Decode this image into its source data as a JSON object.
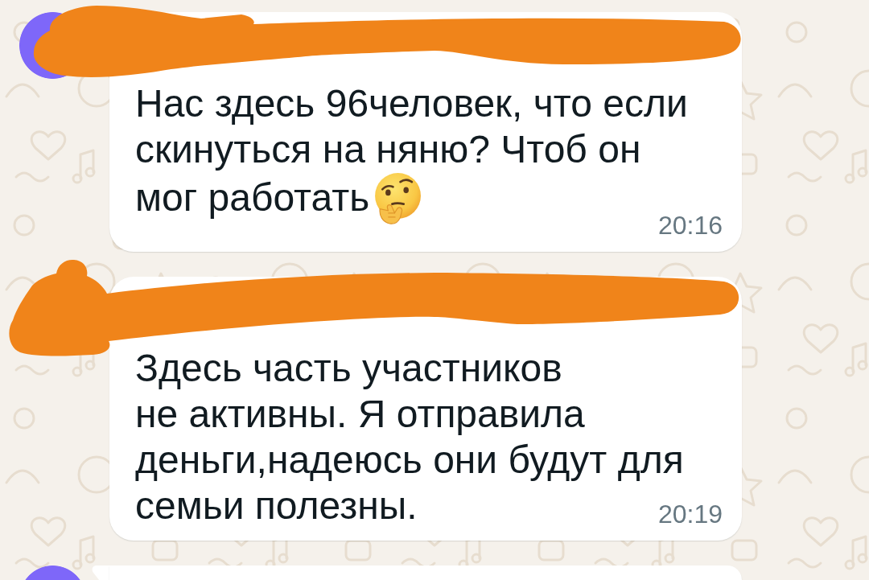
{
  "messages": [
    {
      "kind": "emoji",
      "avatar": true,
      "sender_redacted": true,
      "lines": [
        "Нас здесь 96человек, что если",
        "скинуться на няню? Чтоб он",
        "мог работать"
      ],
      "time": "20:16"
    },
    {
      "kind": "plain",
      "sender_redacted": true,
      "lines": [
        "Здесь часть участников",
        "не активны. Я отправила",
        "деньги,надеюсь они будут для",
        "семьи полезны."
      ],
      "time": "20:19"
    },
    {
      "kind": "clipped",
      "avatar": true
    }
  ]
}
